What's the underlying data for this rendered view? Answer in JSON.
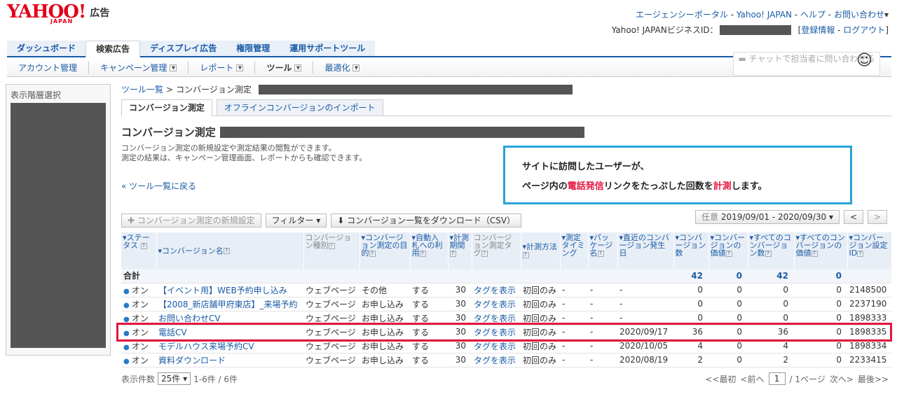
{
  "header": {
    "logo_text": "YAHOO!",
    "logo_sub": "JAPAN",
    "logo_suffix": "広告",
    "top_links": [
      "エージェンシーポータル",
      "Yahoo! JAPAN",
      "ヘルプ",
      "お問い合わせ"
    ],
    "biz_id_label": "Yahoo! JAPANビジネスID：",
    "account_links": [
      "登録情報",
      "ログアウト"
    ]
  },
  "main_tabs": [
    "ダッシュボード",
    "検索広告",
    "ディスプレイ広告",
    "権限管理",
    "運用サポートツール"
  ],
  "sub_nav": [
    "アカウント管理",
    "キャンペーン管理",
    "レポート",
    "ツール",
    "最適化"
  ],
  "chat_label": "チャットで担当者に問い合わせる",
  "sidebar": {
    "label": "表示階層選択"
  },
  "breadcrumb": {
    "link": "ツール一覧",
    "sep": ">",
    "current": "コンバージョン測定"
  },
  "sub_tabs": [
    "コンバージョン測定",
    "オフラインコンバージョンのインポート"
  ],
  "page_title": "コンバージョン測定",
  "description": [
    "コンバージョン測定の新規設定や測定結果の閲覧ができます。",
    "測定の結果は、キャンペーン管理画面、レポートからも確認できます。"
  ],
  "back_link": "« ツール一覧に戻る",
  "callout": {
    "line1": "サイトに訪問したユーザーが、",
    "line2_a": "ページ内の",
    "line2_red1": "電話発信",
    "line2_b": "リンクをたっぷした回数を",
    "line2_red2": "計測",
    "line2_c": "します。"
  },
  "toolbar": {
    "new_btn": "✚ コンバージョン測定の新規設定",
    "filter_btn": "フィルター ▾",
    "download_btn": "⬇ コンバージョン一覧をダウンロード（CSV）"
  },
  "date_range": {
    "label": "任意",
    "value": "2019/09/01 - 2020/09/30",
    "prev": "<",
    "next": ">"
  },
  "columns": [
    "ステータス",
    "コンバージョン名",
    "コンバージョン種別",
    "コンバージョン測定の目的",
    "自動入札への利用",
    "計測期間",
    "コンバージョン測定タグ",
    "計測方法",
    "測定タイミング",
    "パッケージ名",
    "直近のコンバージョン発生日",
    "コンバージョン数",
    "コンバージョンの価値",
    "すべてのコンバージョン数",
    "すべてのコンバージョンの価値",
    "コンバージョン設定ID"
  ],
  "total": {
    "label": "合計",
    "cv": "42",
    "value": "0",
    "all_cv": "42",
    "all_value": "0"
  },
  "rows": [
    {
      "status": "オン",
      "name": "【イベント用】WEB予約申し込み",
      "type": "ウェブページ",
      "purpose": "その他",
      "auto": "する",
      "period": "30",
      "tag": "タグを表示",
      "method": "初回のみ",
      "timing": "-",
      "pkg": "-",
      "last": "-",
      "cv": "0",
      "value": "0",
      "all_cv": "0",
      "all_value": "0",
      "id": "2148500"
    },
    {
      "status": "オン",
      "name": "【2008_新店舗甲府東店】_来場予約",
      "type": "ウェブページ",
      "purpose": "お申し込み",
      "auto": "する",
      "period": "30",
      "tag": "タグを表示",
      "method": "初回のみ",
      "timing": "-",
      "pkg": "-",
      "last": "-",
      "cv": "0",
      "value": "0",
      "all_cv": "0",
      "all_value": "0",
      "id": "2237190"
    },
    {
      "status": "オン",
      "name": "お問い合わせCV",
      "type": "ウェブページ",
      "purpose": "お申し込み",
      "auto": "する",
      "period": "30",
      "tag": "タグを表示",
      "method": "初回のみ",
      "timing": "-",
      "pkg": "-",
      "last": "-",
      "cv": "0",
      "value": "0",
      "all_cv": "0",
      "all_value": "0",
      "id": "1898333"
    },
    {
      "status": "オン",
      "name": "電話CV",
      "type": "ウェブページ",
      "purpose": "お申し込み",
      "auto": "する",
      "period": "30",
      "tag": "タグを表示",
      "method": "初回のみ",
      "timing": "-",
      "pkg": "-",
      "last": "2020/09/17",
      "cv": "36",
      "value": "0",
      "all_cv": "36",
      "all_value": "0",
      "id": "1898335"
    },
    {
      "status": "オン",
      "name": "モデルハウス来場予約CV",
      "type": "ウェブページ",
      "purpose": "お申し込み",
      "auto": "する",
      "period": "30",
      "tag": "タグを表示",
      "method": "初回のみ",
      "timing": "-",
      "pkg": "-",
      "last": "2020/10/05",
      "cv": "4",
      "value": "0",
      "all_cv": "4",
      "all_value": "0",
      "id": "1898334"
    },
    {
      "status": "オン",
      "name": "資料ダウンロード",
      "type": "ウェブページ",
      "purpose": "お申し込み",
      "auto": "する",
      "period": "30",
      "tag": "タグを表示",
      "method": "初回のみ",
      "timing": "-",
      "pkg": "-",
      "last": "2020/08/19",
      "cv": "2",
      "value": "0",
      "all_cv": "2",
      "all_value": "0",
      "id": "2233415"
    }
  ],
  "footer": {
    "per_page_label": "表示件数",
    "per_page": "25件",
    "range": "1-6件 / 6件"
  },
  "pager": {
    "first": "<<最初",
    "prev": "<前へ",
    "page": "1",
    "total": "/ 1ページ",
    "next": "次へ>",
    "last": "最後>>"
  }
}
